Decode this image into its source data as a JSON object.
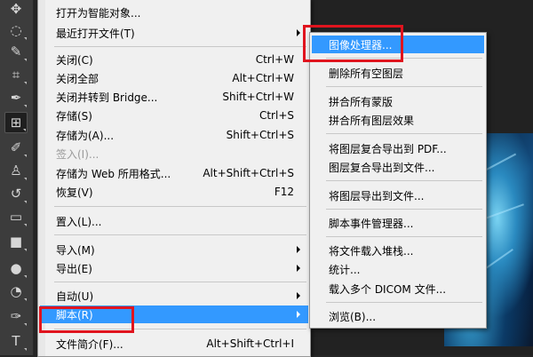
{
  "toolbar": {
    "tools": [
      {
        "name": "move-tool",
        "glyph": "✥"
      },
      {
        "name": "lasso-tool",
        "glyph": "◌"
      },
      {
        "name": "quick-select-tool",
        "glyph": "✎"
      },
      {
        "name": "crop-tool",
        "glyph": "⌗"
      },
      {
        "name": "eyedropper-tool",
        "glyph": "✒"
      },
      {
        "name": "healing-brush-tool",
        "glyph": "⊞"
      },
      {
        "name": "brush-tool",
        "glyph": "✐"
      },
      {
        "name": "clone-stamp-tool",
        "glyph": "♙"
      },
      {
        "name": "history-brush-tool",
        "glyph": "↺"
      },
      {
        "name": "eraser-tool",
        "glyph": "▭"
      },
      {
        "name": "gradient-tool",
        "glyph": "■"
      },
      {
        "name": "blur-tool",
        "glyph": "●"
      },
      {
        "name": "dodge-tool",
        "glyph": "◔"
      },
      {
        "name": "pen-tool",
        "glyph": "✑"
      },
      {
        "name": "type-tool",
        "glyph": "T"
      }
    ]
  },
  "file_menu": {
    "items": [
      {
        "label": "打开为智能对象...",
        "shortcut": ""
      },
      {
        "label": "最近打开文件(T)",
        "shortcut": "",
        "submenu": true
      },
      {
        "label": "关闭(C)",
        "shortcut": "Ctrl+W"
      },
      {
        "label": "关闭全部",
        "shortcut": "Alt+Ctrl+W"
      },
      {
        "label": "关闭并转到 Bridge...",
        "shortcut": "Shift+Ctrl+W"
      },
      {
        "label": "存储(S)",
        "shortcut": "Ctrl+S"
      },
      {
        "label": "存储为(A)...",
        "shortcut": "Shift+Ctrl+S"
      },
      {
        "label": "签入(I)...",
        "shortcut": "",
        "disabled": true
      },
      {
        "label": "存储为 Web 所用格式...",
        "shortcut": "Alt+Shift+Ctrl+S"
      },
      {
        "label": "恢复(V)",
        "shortcut": "F12"
      },
      {
        "label": "置入(L)...",
        "shortcut": ""
      },
      {
        "label": "导入(M)",
        "shortcut": "",
        "submenu": true
      },
      {
        "label": "导出(E)",
        "shortcut": "",
        "submenu": true
      },
      {
        "label": "自动(U)",
        "shortcut": "",
        "submenu": true
      },
      {
        "label": "脚本(R)",
        "shortcut": "",
        "submenu": true,
        "highlighted": true
      },
      {
        "label": "文件简介(F)...",
        "shortcut": "Alt+Shift+Ctrl+I"
      }
    ]
  },
  "scripts_submenu": {
    "items": [
      {
        "label": "图像处理器...",
        "highlighted": true
      },
      {
        "label": "删除所有空图层"
      },
      {
        "label": "拼合所有蒙版"
      },
      {
        "label": "拼合所有图层效果"
      },
      {
        "label": "将图层复合导出到 PDF..."
      },
      {
        "label": "图层复合导出到文件..."
      },
      {
        "label": "将图层导出到文件..."
      },
      {
        "label": "脚本事件管理器..."
      },
      {
        "label": "将文件载入堆栈..."
      },
      {
        "label": "统计..."
      },
      {
        "label": "载入多个 DICOM 文件..."
      },
      {
        "label": "浏览(B)..."
      }
    ]
  },
  "colors": {
    "highlight": "#3399ff",
    "annotation": "#e0141e",
    "menu_bg": "#f0f0f0",
    "toolbar_bg": "#3c3c3c"
  }
}
